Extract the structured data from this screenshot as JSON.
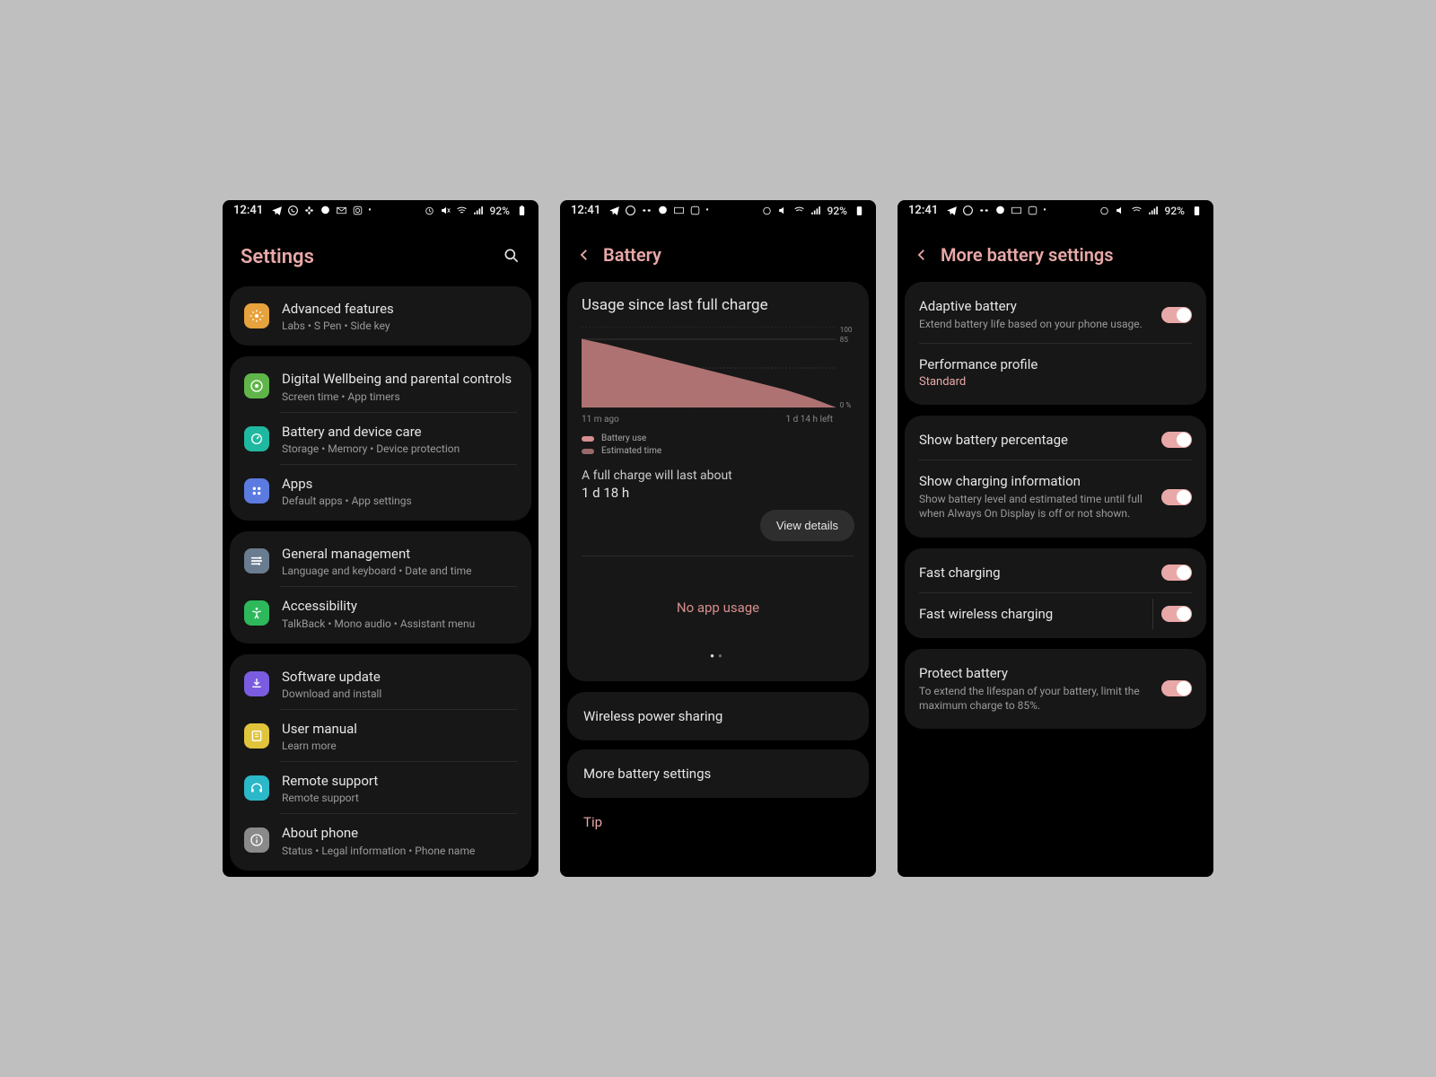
{
  "status": {
    "time": "12:41",
    "battery_pct": "92%"
  },
  "screen1": {
    "title": "Settings",
    "groups": [
      {
        "items": [
          {
            "icon": "advanced",
            "color": "#e6a23c",
            "title": "Advanced features",
            "sub": "Labs  •  S Pen  •  Side key"
          }
        ]
      },
      {
        "items": [
          {
            "icon": "wellbeing",
            "color": "#60b54a",
            "title": "Digital Wellbeing and parental controls",
            "sub": "Screen time  •  App timers"
          },
          {
            "icon": "care",
            "color": "#1fb8a0",
            "title": "Battery and device care",
            "sub": "Storage  •  Memory  •  Device protection"
          },
          {
            "icon": "apps",
            "color": "#5b7be0",
            "title": "Apps",
            "sub": "Default apps  •  App settings"
          }
        ]
      },
      {
        "items": [
          {
            "icon": "general",
            "color": "#6a7c8f",
            "title": "General management",
            "sub": "Language and keyboard  •  Date and time"
          },
          {
            "icon": "accessibility",
            "color": "#2eb85c",
            "title": "Accessibility",
            "sub": "TalkBack  •  Mono audio  •  Assistant menu"
          }
        ]
      },
      {
        "items": [
          {
            "icon": "update",
            "color": "#7a5ce0",
            "title": "Software update",
            "sub": "Download and install"
          },
          {
            "icon": "manual",
            "color": "#e0c43c",
            "title": "User manual",
            "sub": "Learn more"
          },
          {
            "icon": "support",
            "color": "#2bb8c9",
            "title": "Remote support",
            "sub": "Remote support"
          },
          {
            "icon": "about",
            "color": "#8a8a8a",
            "title": "About phone",
            "sub": "Status  •  Legal information  •  Phone name"
          }
        ]
      }
    ]
  },
  "screen2": {
    "title": "Battery",
    "section_title": "Usage since last full charge",
    "time_left_label": "11 m ago",
    "time_right_label": "1 d 14 h left",
    "legend1": "Battery use",
    "legend2": "Estimated time",
    "estimate_label": "A full charge will last about",
    "estimate_value": "1 d 18 h",
    "view_details": "View details",
    "no_usage": "No app usage",
    "row1": "Wireless power sharing",
    "row2": "More battery settings",
    "tip": "Tip"
  },
  "screen3": {
    "title": "More battery settings",
    "g1": [
      {
        "title": "Adaptive battery",
        "sub": "Extend battery life based on your phone usage.",
        "toggle": true
      },
      {
        "title": "Performance profile",
        "val": "Standard"
      }
    ],
    "g2": [
      {
        "title": "Show battery percentage",
        "toggle": true
      },
      {
        "title": "Show charging information",
        "sub": "Show battery level and estimated time until full when Always On Display is off or not shown.",
        "toggle": true
      }
    ],
    "g3": [
      {
        "title": "Fast charging",
        "toggle": true
      },
      {
        "title": "Fast wireless charging",
        "toggle": true,
        "vdiv": true
      }
    ],
    "g4": [
      {
        "title": "Protect battery",
        "sub": "To extend the lifespan of your battery, limit the maximum charge to 85%.",
        "toggle": true
      }
    ]
  },
  "chart_data": {
    "type": "area",
    "title": "Usage since last full charge",
    "x_range": [
      "11 m ago",
      "1 d 14 h left"
    ],
    "y_ticks": [
      100,
      85,
      0
    ],
    "ylabel": "%",
    "series": [
      {
        "name": "Battery use",
        "color": "#d68e8e",
        "points": [
          {
            "t": 0.0,
            "pct": 85
          },
          {
            "t": 0.1,
            "pct": 78
          },
          {
            "t": 0.2,
            "pct": 70
          },
          {
            "t": 0.3,
            "pct": 62
          },
          {
            "t": 0.4,
            "pct": 54
          },
          {
            "t": 0.5,
            "pct": 46
          },
          {
            "t": 0.6,
            "pct": 38
          },
          {
            "t": 0.7,
            "pct": 30
          },
          {
            "t": 0.8,
            "pct": 22
          },
          {
            "t": 0.9,
            "pct": 12
          },
          {
            "t": 1.0,
            "pct": 0
          }
        ]
      }
    ],
    "annotations": {
      "full_charge_estimate": "1 d 18 h"
    }
  }
}
